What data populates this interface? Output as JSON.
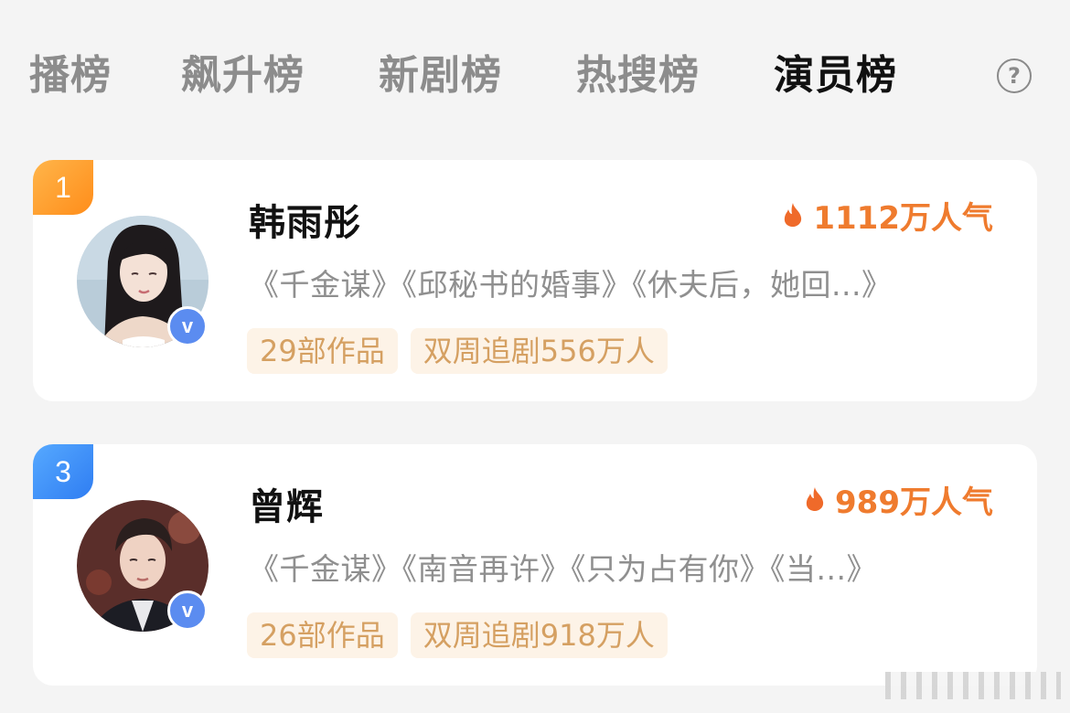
{
  "tabs": [
    {
      "label": "播榜",
      "active": false
    },
    {
      "label": "飙升榜",
      "active": false
    },
    {
      "label": "新剧榜",
      "active": false
    },
    {
      "label": "热搜榜",
      "active": false
    },
    {
      "label": "演员榜",
      "active": true
    }
  ],
  "help": {
    "label": "?",
    "icon": "question-circle-icon"
  },
  "actors": [
    {
      "rank": "1",
      "rank_color": "#ff9a2a",
      "name": "韩雨彤",
      "popularity": "1112万人气",
      "works": "《千金谋》《邱秘书的婚事》《休夫后，她回...》",
      "tags": [
        "29部作品",
        "双周追剧556万人"
      ],
      "verified_badge": "v"
    },
    {
      "rank": "3",
      "rank_color": "#3d8bf5",
      "name": "曾辉",
      "popularity": "989万人气",
      "works": "《千金谋》《南音再许》《只为占有你》《当...》",
      "tags": [
        "26部作品",
        "双周追剧918万人"
      ],
      "verified_badge": "v"
    }
  ],
  "colors": {
    "accent_orange": "#ef7b2e",
    "tag_text": "#d5a062",
    "tag_bg": "#fdf3e7",
    "verified": "#5b8cf0"
  }
}
